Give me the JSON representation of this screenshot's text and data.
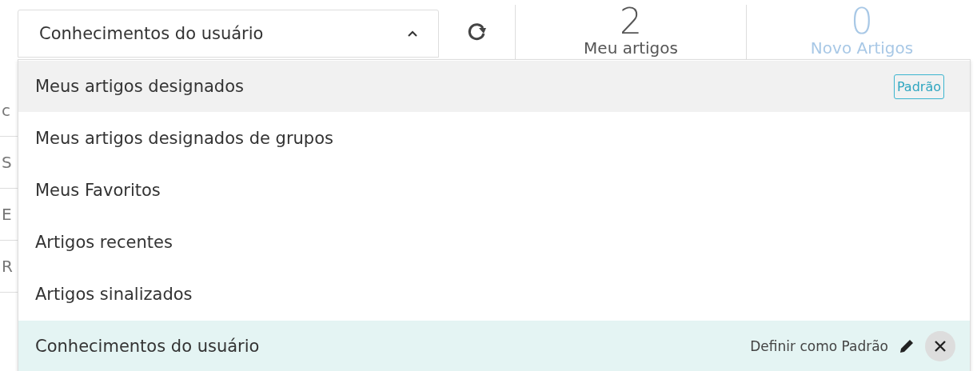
{
  "select": {
    "value": "Conhecimentos do usuário",
    "expanded": true
  },
  "stats": [
    {
      "count": "2",
      "label": "Meu artigos",
      "muted": false
    },
    {
      "count": "0",
      "label": "Novo Artigos",
      "muted": true
    }
  ],
  "background_rows": [
    "c",
    "S",
    "E",
    "R"
  ],
  "menu": [
    {
      "label": "Meus artigos designados",
      "selected": false,
      "hovered": true,
      "badge": "Padrão"
    },
    {
      "label": "Meus artigos designados de grupos",
      "selected": false,
      "hovered": false
    },
    {
      "label": "Meus Favoritos",
      "selected": false,
      "hovered": false
    },
    {
      "label": "Artigos recentes",
      "selected": false,
      "hovered": false
    },
    {
      "label": "Artigos sinalizados",
      "selected": false,
      "hovered": false
    },
    {
      "label": "Conhecimentos do usuário",
      "selected": true,
      "hovered": false,
      "action": "Definir como Padrão"
    }
  ]
}
